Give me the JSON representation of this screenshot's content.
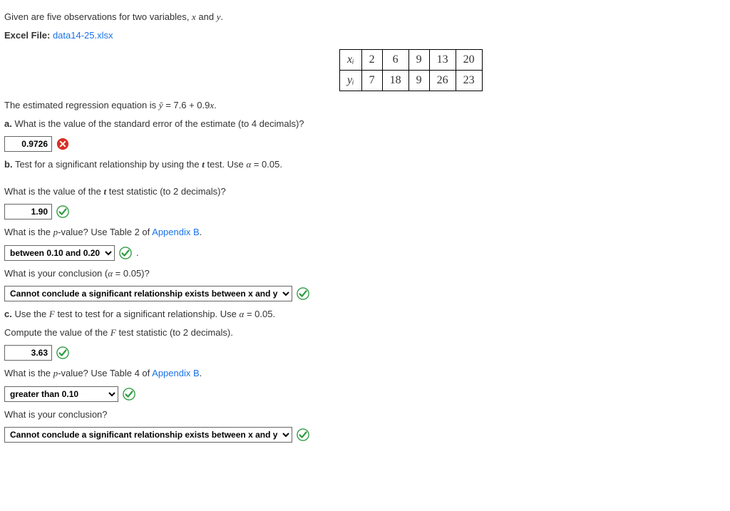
{
  "intro": "Given are five observations for two variables, x and y.",
  "excel_label": "Excel File:",
  "excel_link": "data14-25.xlsx",
  "table": {
    "row1_head": "xᵢ",
    "row1": [
      "2",
      "6",
      "9",
      "13",
      "20"
    ],
    "row2_head": "yᵢ",
    "row2": [
      "7",
      "18",
      "9",
      "26",
      "23"
    ]
  },
  "regression_line": "The estimated regression equation is ŷ = 7.6 + 0.9x.",
  "a_prompt": "a. What is the value of the standard error of the estimate (to 4 decimals)?",
  "a_value": "0.9726",
  "b_prompt": "b. Test for a significant relationship by using the t test. Use α = 0.05.",
  "t_stat_prompt": "What is the value of the t test statistic (to 2 decimals)?",
  "t_stat_value": "1.90",
  "p_val_prompt_b": "What is the p-value? Use Table 2 of ",
  "appendix_b": "Appendix B",
  "p_val_b_select": "between 0.10 and 0.20",
  "conclusion_prompt_b": "What is your conclusion (α = 0.05)?",
  "conclusion_b_select": "Cannot conclude a significant relationship exists between x and y",
  "c_prompt": "c. Use the F test to test for a significant relationship. Use α = 0.05.",
  "f_compute_prompt": "Compute the value of the F test statistic (to 2 decimals).",
  "f_value": "3.63",
  "p_val_prompt_c": "What is the p-value? Use Table 4 of ",
  "p_val_c_select": "greater than 0.10",
  "conclusion_prompt_c": "What is your conclusion?",
  "conclusion_c_select": "Cannot conclude a significant relationship exists between x and y"
}
